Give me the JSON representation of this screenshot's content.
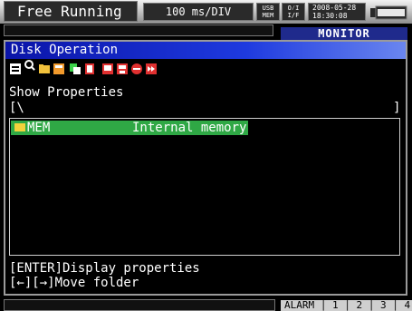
{
  "status_bar": {
    "mode": "Free Running",
    "timebase": "100 ms/DIV",
    "usb_label": "USB",
    "mem_label": "MEM",
    "io_top": "O⁄I",
    "io_bottom": "I/F",
    "date": "2008-05-28",
    "time": "18:30:08",
    "battery_icon": "battery-icon"
  },
  "mode_badge": "MONITOR",
  "dialog": {
    "title": "Disk Operation",
    "toolbar_icons": [
      "properties-icon",
      "search-icon",
      "folder-open-icon",
      "file-save-icon",
      "copy-icon",
      "delete-icon",
      "screen-icon",
      "save-icon",
      "record-icon",
      "fast-forward-icon"
    ],
    "current_command": "Show Properties",
    "path_open": "[\\",
    "path_close": "]",
    "files": [
      {
        "name": "MEM",
        "description": "Internal memory",
        "icon": "folder-icon",
        "selected": true
      }
    ],
    "help_line1": "[ENTER]Display properties",
    "help_line2": "[←][→]Move folder"
  },
  "bottom_bar": {
    "alarm_label": "ALARM",
    "channels": [
      "1",
      "2",
      "3",
      "4"
    ]
  },
  "colors": {
    "title_bar": "#1e3adf",
    "selection": "#2fa845",
    "monitor_badge": "#1f2a8c"
  }
}
